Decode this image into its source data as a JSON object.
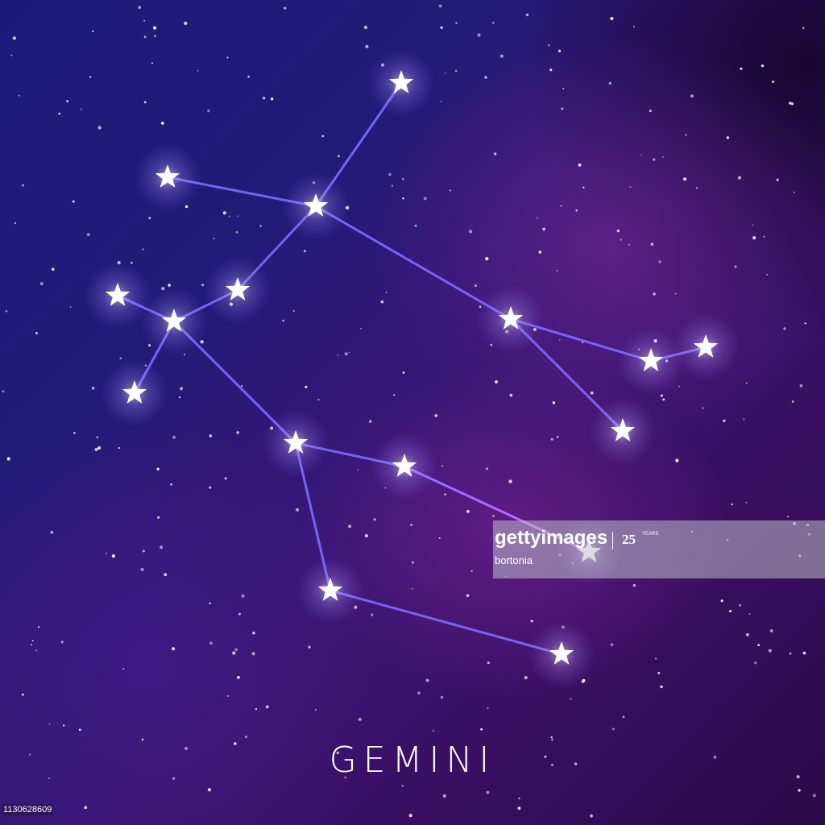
{
  "title": "GEMINI",
  "watermark": {
    "brand": "gettyimages",
    "years": "25",
    "years_label": "YEARS",
    "author": "bortonia"
  },
  "image_id": "1130628609",
  "colors": {
    "line": "#7f6cff",
    "line_pink": "#d35cff",
    "star": "#ffffff"
  }
}
